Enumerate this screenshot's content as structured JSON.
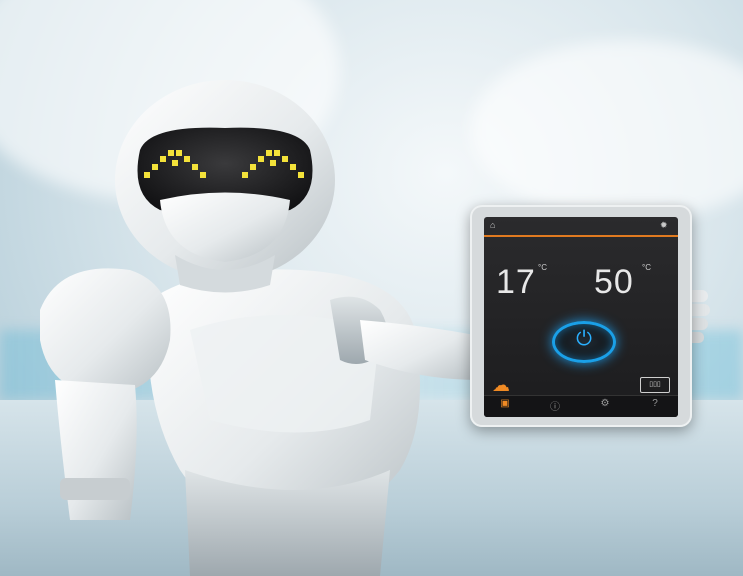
{
  "scene": {
    "subject": "robot",
    "colors": {
      "accent": "#1aa0e8",
      "tab_active": "#f08a24",
      "screen_bg": "#1c1c1e"
    }
  },
  "tablet": {
    "temp_left_value": "17",
    "temp_right_value": "50",
    "unit": "°C",
    "icons": [
      "settings-icon",
      "power-icon",
      "weather-icon",
      "heater-icon"
    ]
  }
}
